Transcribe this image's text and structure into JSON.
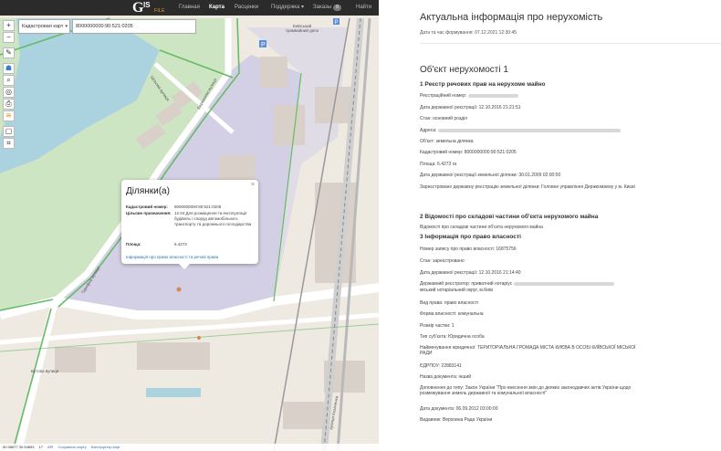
{
  "navbar": {
    "logo": {
      "main": "G",
      "accent": "IS",
      "sub": "FILE"
    },
    "links": [
      {
        "label": "Главная"
      },
      {
        "label": "Карта"
      },
      {
        "label": "Расценки"
      },
      {
        "label": "Поддержка ▾"
      },
      {
        "label": "Заказы"
      },
      {
        "label": "Найти"
      }
    ],
    "orders_badge": "0"
  },
  "map": {
    "layer_select": "Кадастровая карт",
    "search_value": "8000000000:90:521:0205",
    "labels": {
      "street_1": "Цільова вулиця",
      "street_2": "Березнева вулиця",
      "area": "Київський трамвайний депо",
      "street_3": "Тарифна вулиця",
      "street_4": "вулиця Козаченка",
      "street_5": "Бутова вулиця"
    },
    "popup": {
      "title": "Ділянки(а)",
      "rows": [
        {
          "key": "Кадастровий номер:",
          "value": "8000000000:90:521:0205"
        },
        {
          "key": "Цільове призначення:",
          "value": "12.04 Для розміщення та експлуатації будівель і споруд автомобільного транспорту та дорожнього господарства"
        },
        {
          "key": "Площа:",
          "value": "6.4273"
        }
      ],
      "link": "Інформація про право власності та речові права"
    },
    "status": {
      "coords": "50.38677 30.54653",
      "zoom": "17",
      "api": "API",
      "save": "Сохранить карту",
      "builder": "Конструктор карт"
    }
  },
  "info": {
    "title": "Актуальна інформація про нерухомість",
    "date": "Дата та час формування: 07.12.2021 12:30:45",
    "object_title": "Об'єкт нерухомості 1",
    "section1": "1 Реєстр речових прав на нерухоме майно",
    "reg_number_label": "Реєстраційний номер:",
    "reg_date": "Дата державної реєстрації: 12.10.2016 21:21:51",
    "status": "Стан: основний розділ",
    "address_label": "Адреса:",
    "object_type": "Об'єкт: земельна ділянка",
    "cadastral": "Кадастровий номер: 8000000000:90:521:0205",
    "area": "Площа: 6.4273 га",
    "land_reg_date": "Дата державної реєстрації земельної ділянки: 30.01.2009 02:00:00",
    "registered_by": "Зареєстровано державну реєстрацію земельної ділянки: Головне управління Держкомзему у м. Києві",
    "section2": "2 Відомості про складові частини об'єкта нерухомого майна",
    "section2_text": "Відомості про складові частини об'єкта нерухомого майна",
    "section3": "3 Інформація про право власності",
    "record_number": "Номер запису про право власності: 16875756",
    "record_status": "Стан: зареєстровано",
    "record_date": "Дата державної реєстрації: 12.10.2016 21:14:40",
    "registrar": "Державний реєстратор: приватний нотаріус",
    "registrar_2": "міський нотаріальний округ, м.Київ",
    "right_type": "Вид права: право власності",
    "ownership_form": "Форма власності: комунальна",
    "share": "Розмір частки: 1",
    "subject_type": "Тип суб'єкта: Юридична особа",
    "legal_name": "Найменування юридичної: ТЕРИТОРІАЛЬНА ГРОМАДА МІСТА КИЄВА В ОСОБІ КИЇВСЬКОЇ МІСЬКОЇ РАДИ",
    "edrpou": "ЄДРПОУ: 22883141",
    "doc_name": "Назва документа: інший",
    "addition": "Доповнення до типу: Закон України \"Про внесення змін до деяких законодавчих актів України щодо розмежування земель державної та комунальної власності\"",
    "doc_date": "Дата документа: 06.09.2012 03:00:00",
    "issuer": "Видавник: Верховна Рада України"
  }
}
